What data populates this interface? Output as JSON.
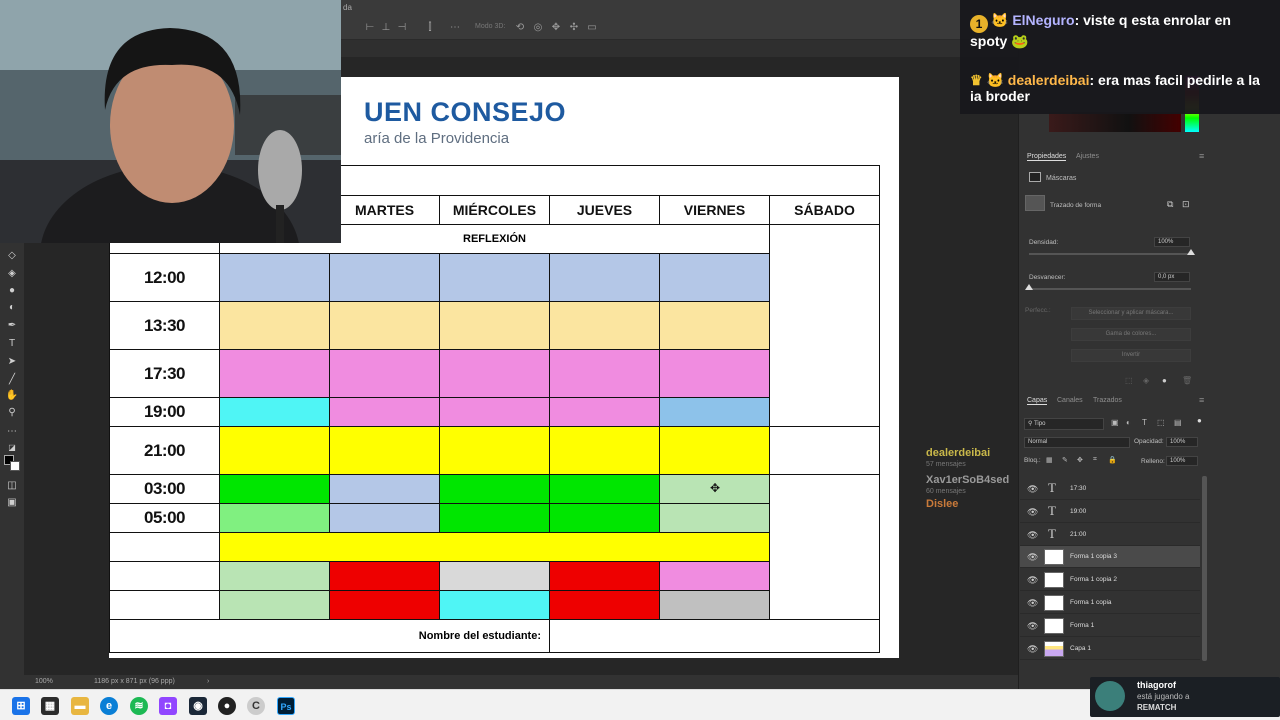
{
  "window": {
    "title": "da"
  },
  "options_bar": {
    "mode_label": "Modo 3D:"
  },
  "document": {
    "logo_title": "UEN CONSEJO",
    "logo_subtitle": "aría de la Providencia",
    "days": [
      "MARTES",
      "MIÉRCOLES",
      "JUEVES",
      "VIERNES",
      "SÁBADO"
    ],
    "reflexion": "REFLEXIÓN",
    "times": [
      "12:00",
      "13:30",
      "17:30",
      "19:00",
      "21:00",
      "03:00",
      "05:00"
    ],
    "student_label": "Nombre del estudiante:",
    "colors": {
      "blue": "#b4c7e7",
      "peach": "#fbe5a0",
      "pink": "#f08ce0",
      "cyan": "#4ff5f5",
      "skyblue": "#8dc2ea",
      "yellow": "#ffff00",
      "green": "#00e600",
      "lightgreen": "#80f080",
      "palegreen": "#b9e4b4",
      "red": "#ee0000",
      "lightgray": "#d9d9d9",
      "gray": "#c0c0c0"
    }
  },
  "status": {
    "zoom": "100%",
    "doc_info": "1186 px x 871 px (96 ppp)"
  },
  "properties": {
    "tabs": [
      "Propiedades",
      "Ajustes"
    ],
    "section": "Máscaras",
    "mask_type": "Trazado de forma",
    "density_label": "Densidad:",
    "density_value": "100%",
    "density_level": 1.0,
    "feather_label": "Desvanecer:",
    "feather_value": "0,0 px",
    "feather_level": 0.0,
    "perfect_label": "Perfecc.:",
    "btn_select_mask": "Seleccionar y aplicar máscara...",
    "btn_color_range": "Gama de colores...",
    "btn_invert": "Invertir"
  },
  "layers": {
    "tabs": [
      "Capas",
      "Canales",
      "Trazados"
    ],
    "filter": "Tipo",
    "blend_mode": "Normal",
    "opacity_label": "Opacidad:",
    "opacity_value": "100%",
    "lock_label": "Bloq.:",
    "fill_label": "Relleno:",
    "fill_value": "100%",
    "items": [
      {
        "name": "17:30",
        "kind": "text"
      },
      {
        "name": "19:00",
        "kind": "text"
      },
      {
        "name": "21:00",
        "kind": "text"
      },
      {
        "name": "Forma 1 copia 3",
        "kind": "shape",
        "selected": true
      },
      {
        "name": "Forma 1 copia 2",
        "kind": "shape"
      },
      {
        "name": "Forma 1 copia",
        "kind": "shape"
      },
      {
        "name": "Forma 1",
        "kind": "shape"
      },
      {
        "name": "Capa 1",
        "kind": "image"
      }
    ]
  },
  "chat": {
    "line1_badge": "1",
    "line1_user": "ElNeguro",
    "line1_msg": ": viste q esta enrolar en spoty",
    "line2_user": "dealerdeibai",
    "line2_msg": ": era mas facil pedirle a la ia broder"
  },
  "leaderboard": [
    {
      "name": "dealerdeibai",
      "sub": "57 mensajes",
      "color": "#c9b84a"
    },
    {
      "name": "Xav1erSoB4sed",
      "sub": "60 mensajes",
      "color": "#9a9a9a"
    },
    {
      "name": "Dislee",
      "sub": "",
      "color": "#c97a3a"
    }
  ],
  "activity": {
    "user": "thiagorof",
    "status": "está jugando a",
    "game": "REMATCH"
  }
}
